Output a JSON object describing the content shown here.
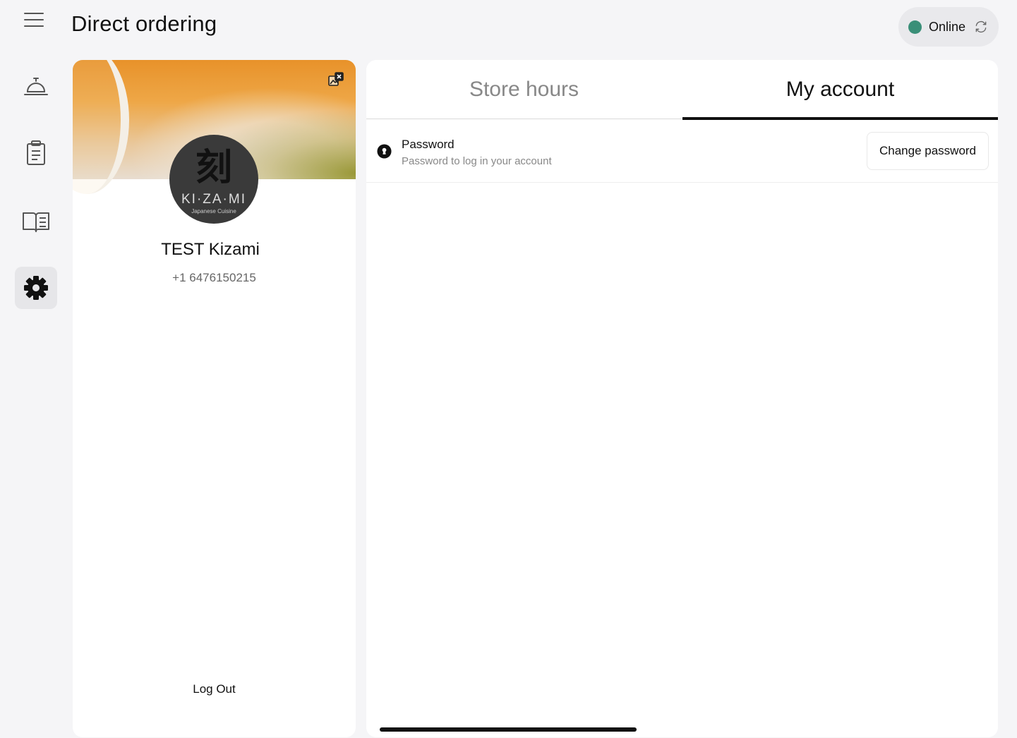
{
  "header": {
    "title": "Direct ordering",
    "status": {
      "label": "Online",
      "dot_color": "#3a8f78"
    }
  },
  "sidebar": {
    "items": [
      {
        "name": "orders",
        "icon": "service-bell-icon",
        "active": false
      },
      {
        "name": "order-history",
        "icon": "clipboard-icon",
        "active": false
      },
      {
        "name": "menu",
        "icon": "open-book-icon",
        "active": false
      },
      {
        "name": "settings",
        "icon": "gear-icon",
        "active": true
      }
    ]
  },
  "profile": {
    "store_name": "TEST Kizami",
    "phone": "+1 6476150215",
    "logo": {
      "kanji": "刻",
      "wordmark": "KI·ZA·MI",
      "subtitle": "Japanese Cuisine"
    },
    "logout_label": "Log Out"
  },
  "tabs": [
    {
      "label": "Store hours",
      "active": false
    },
    {
      "label": "My account",
      "active": true
    }
  ],
  "account": {
    "password": {
      "title": "Password",
      "description": "Password to log in your account",
      "button_label": "Change password"
    }
  }
}
